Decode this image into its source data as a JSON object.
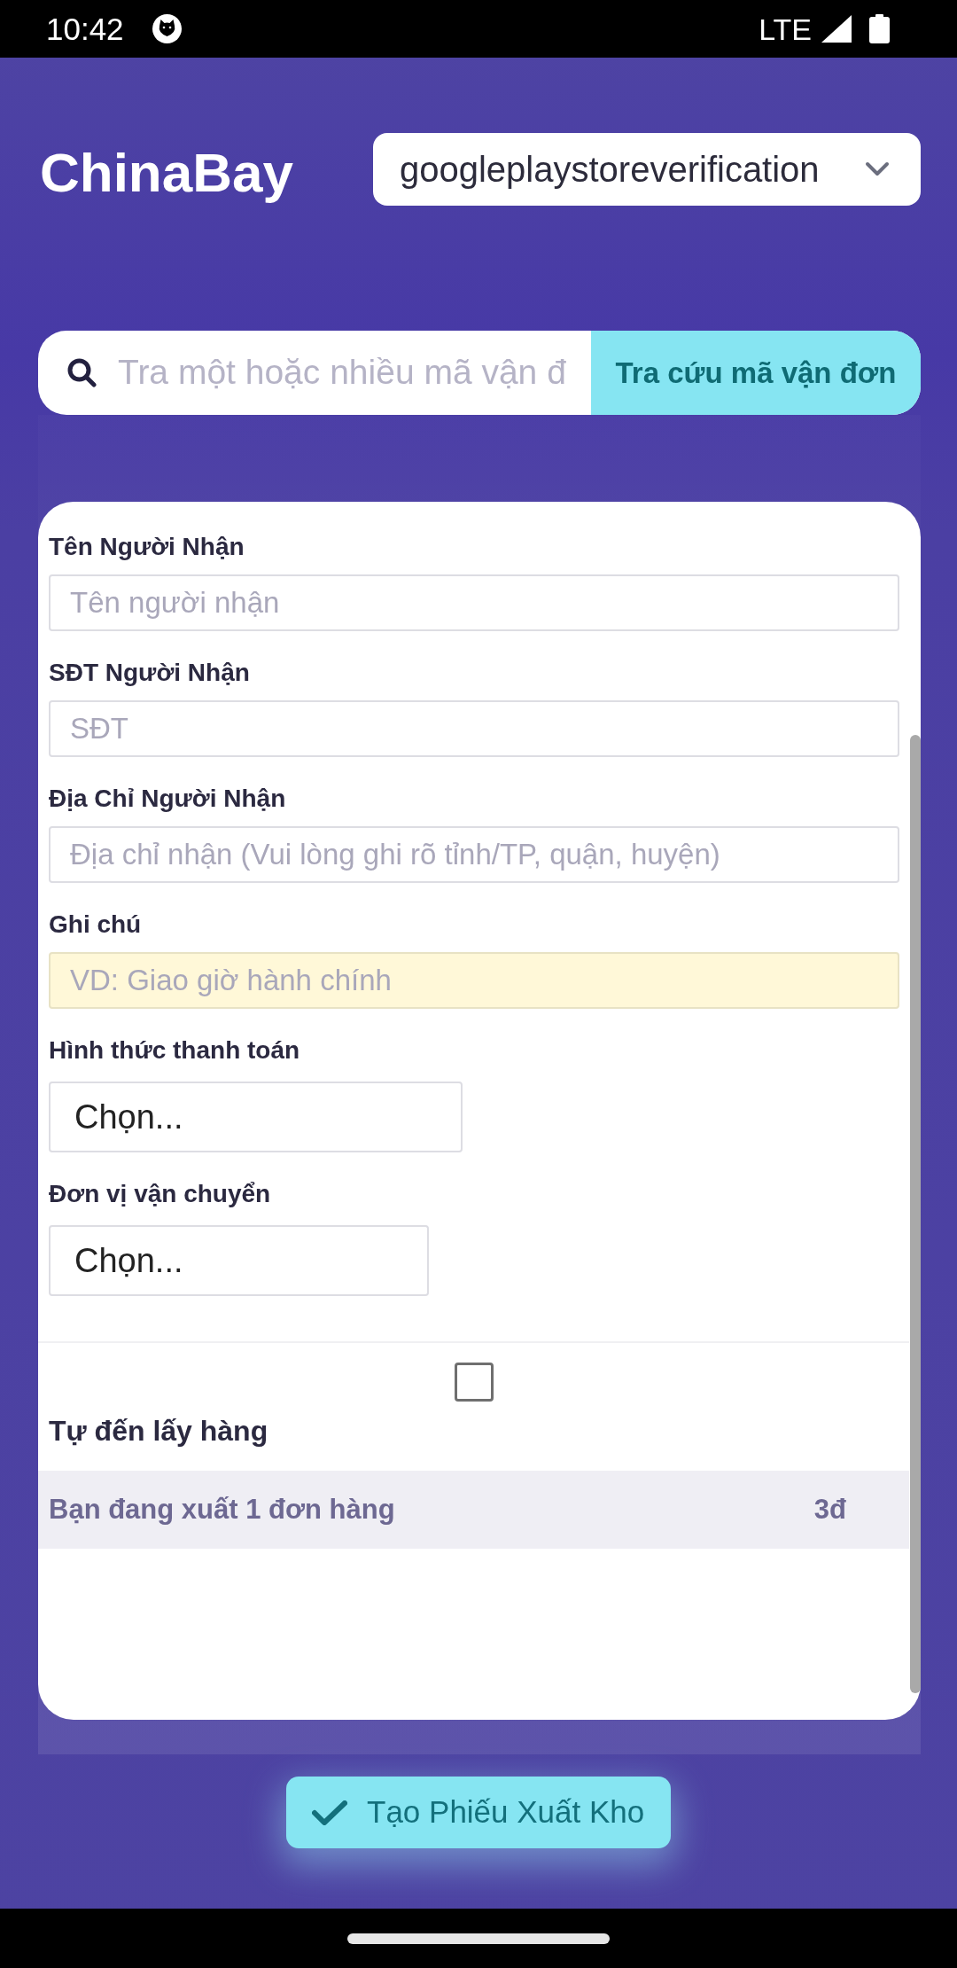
{
  "status_bar": {
    "time": "10:42",
    "network": "LTE"
  },
  "header": {
    "logo": "ChinaBay",
    "account_dropdown": {
      "value": "googleplaystoreverification"
    }
  },
  "search": {
    "placeholder": "Tra một hoặc nhiều mã vận đ",
    "button": "Tra cứu mã vận đơn"
  },
  "form": {
    "fields": [
      {
        "kind": "text",
        "label": "Tên Người Nhận",
        "placeholder": "Tên người nhận",
        "highlighted": false
      },
      {
        "kind": "text",
        "label": "SĐT Người Nhận",
        "placeholder": "SĐT",
        "highlighted": false
      },
      {
        "kind": "text",
        "label": "Địa Chỉ Người Nhận",
        "placeholder": "Địa chỉ nhận (Vui lòng ghi rõ tỉnh/TP, quận, huyện)",
        "highlighted": false
      },
      {
        "kind": "text",
        "label": "Ghi chú",
        "placeholder": "VD: Giao giờ hành chính",
        "highlighted": true
      },
      {
        "kind": "select",
        "label": "Hình thức thanh toán",
        "value": "Chọn..."
      },
      {
        "kind": "select",
        "label": "Đơn vị vận chuyển",
        "value": "Chọn..."
      }
    ],
    "pickup": {
      "checked": false,
      "label": "Tự đến lấy hàng"
    },
    "summary": {
      "text": "Bạn đang xuất 1 đơn hàng",
      "amount": "3đ"
    }
  },
  "submit_button": {
    "label": "Tạo Phiếu Xuất Kho"
  }
}
